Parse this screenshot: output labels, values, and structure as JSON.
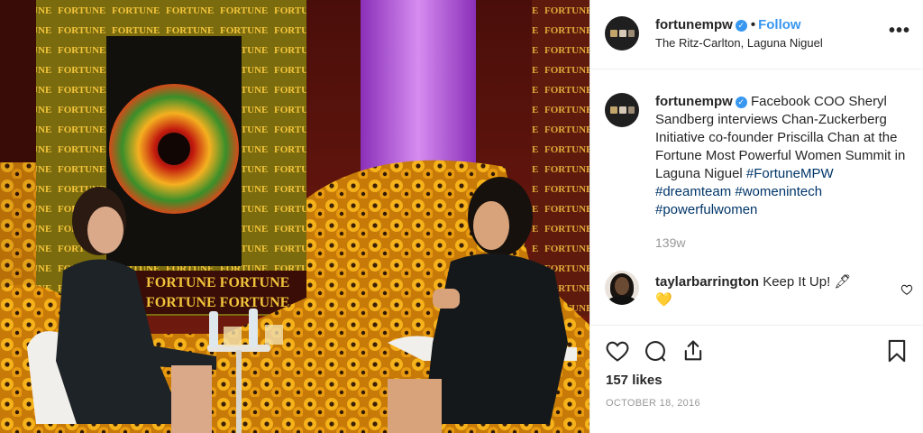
{
  "post": {
    "header": {
      "username": "fortunempw",
      "verified_icon": "verified-badge-icon",
      "separator": "•",
      "follow_label": "Follow",
      "location": "The Ritz-Carlton, Laguna Niguel",
      "more_label": "•••"
    },
    "caption": {
      "username": "fortunempw",
      "text": "Facebook COO Sheryl Sandberg interviews Chan-Zuckerberg Initiative co-founder Priscilla Chan at the Fortune Most Powerful Women Summit in Laguna Niguel",
      "hashtags": "#FortuneMPW #dreamteam #womenintech #powerfulwomen",
      "time": "139w"
    },
    "comment": {
      "username": "taylarbarrington",
      "text": "Keep It Up! 🖋",
      "emoji": "💛"
    },
    "stats": {
      "likes": "157 likes",
      "date": "OCTOBER 18, 2016"
    },
    "photo": {
      "backdrop_text": "FORTUNE",
      "colors": {
        "wall": "#6a1a12",
        "panel": "#8a7a12",
        "purple": "#b04ad8",
        "sunflower": "#f2a70c"
      }
    },
    "colors": {
      "accent": "#3897f0",
      "hashtag": "#003569",
      "muted": "#999999",
      "border": "#efefef"
    }
  }
}
